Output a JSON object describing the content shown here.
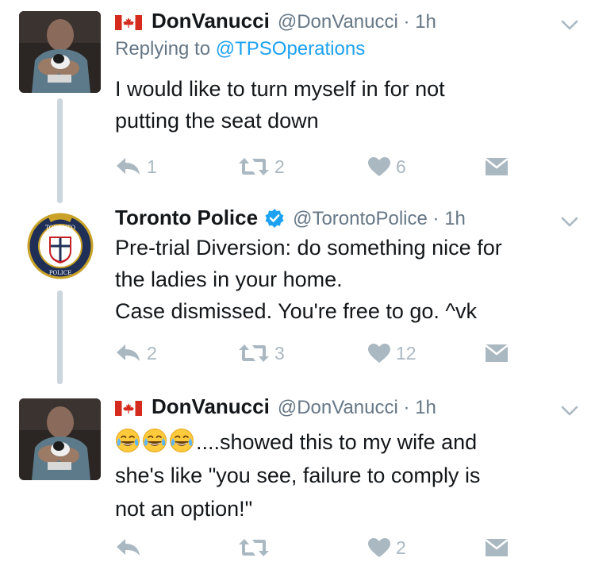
{
  "tweets": [
    {
      "display_name": "DonVanucci",
      "handle": "@DonVanucci",
      "separator": "·",
      "time": "1h",
      "replying_prefix": "Replying to",
      "replying_to": "@TPSOperations",
      "text_lines": [
        "I would like to turn myself in for not",
        "putting the seat down"
      ],
      "reply_count": "1",
      "retweet_count": "2",
      "like_count": "6"
    },
    {
      "display_name": "Toronto Police",
      "handle": "@TorontoPolice",
      "separator": "·",
      "time": "1h",
      "text_lines": [
        "Pre-trial Diversion: do something nice for",
        "the ladies in your home.",
        "Case dismissed.  You're free to go. ^vk"
      ],
      "reply_count": "2",
      "retweet_count": "3",
      "like_count": "12"
    },
    {
      "display_name": "DonVanucci",
      "handle": "@DonVanucci",
      "separator": "·",
      "time": "1h",
      "text_lines": [
        "....showed this to my wife and",
        "she's like \"you see, failure to comply is",
        "not an option!\""
      ],
      "reply_count": "",
      "retweet_count": "",
      "like_count": "2"
    }
  ],
  "badge_text": {
    "top": "TORONTO",
    "bottom": "POLICE"
  },
  "colors": {
    "name": "#14171a",
    "handle": "#657786",
    "mention": "#1da1f2",
    "icon_gray": "#aab8c2",
    "verified": "#1da1f2",
    "thread_line": "#ccd6dd",
    "flag_red": "#d52b1e"
  },
  "icons": {
    "flag": "canada-flag-icon",
    "verified": "verified-badge-icon",
    "reply": "reply-icon",
    "retweet": "retweet-icon",
    "like": "heart-icon",
    "dm": "envelope-icon",
    "more": "chevron-down-icon",
    "emoji": "face-with-tears-of-joy-icon"
  }
}
